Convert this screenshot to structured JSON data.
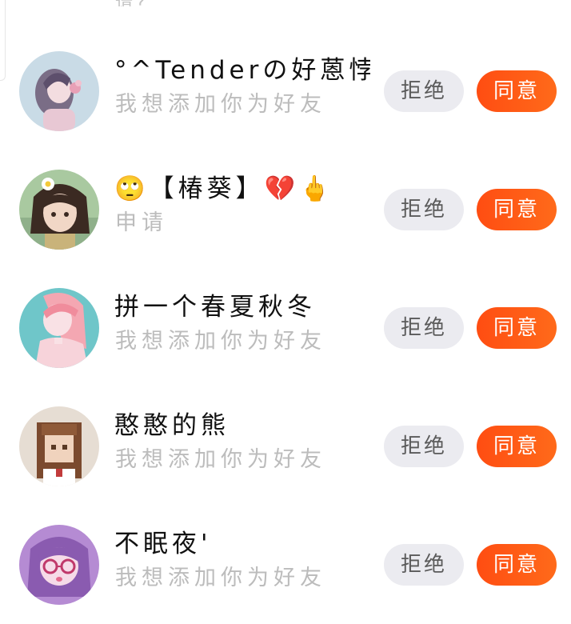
{
  "partial_top_text": "请?",
  "requests": [
    {
      "name": "°^Tenderの好蒽悖°",
      "message": "我想添加你为好友",
      "avatar_icon": "anime-girl-with-flower-icon",
      "avatar_palette": [
        "#c9dbe6",
        "#e8c8d4",
        "#7a6d86"
      ]
    },
    {
      "name": "🙄【椿葵】💔🖕",
      "message": "申请",
      "avatar_icon": "anime-girl-with-daisy-icon",
      "avatar_palette": [
        "#a9c9a0",
        "#3b2a22",
        "#f1d7c6"
      ]
    },
    {
      "name": "拼一个春夏秋冬",
      "message": "我想添加你为好友",
      "avatar_icon": "pink-hair-girl-icon",
      "avatar_palette": [
        "#6fc6c9",
        "#f4a7b2",
        "#f9e1e5"
      ]
    },
    {
      "name": "憨憨的熊",
      "message": "我想添加你为好友",
      "avatar_icon": "pixel-art-girl-icon",
      "avatar_palette": [
        "#e6ddd3",
        "#7b4a2e",
        "#f0d3bd"
      ]
    },
    {
      "name": "不眠夜'",
      "message": "我想添加你为好友",
      "avatar_icon": "purple-hair-girl-with-glasses-icon",
      "avatar_palette": [
        "#b58bd3",
        "#8a5bb0",
        "#f6dbe8"
      ]
    }
  ],
  "buttons": {
    "reject_label": "拒绝",
    "accept_label": "同意"
  },
  "colors": {
    "accent": "#ff5214",
    "reject_bg": "#ebebf0",
    "subtitle": "#bcbcbc"
  }
}
